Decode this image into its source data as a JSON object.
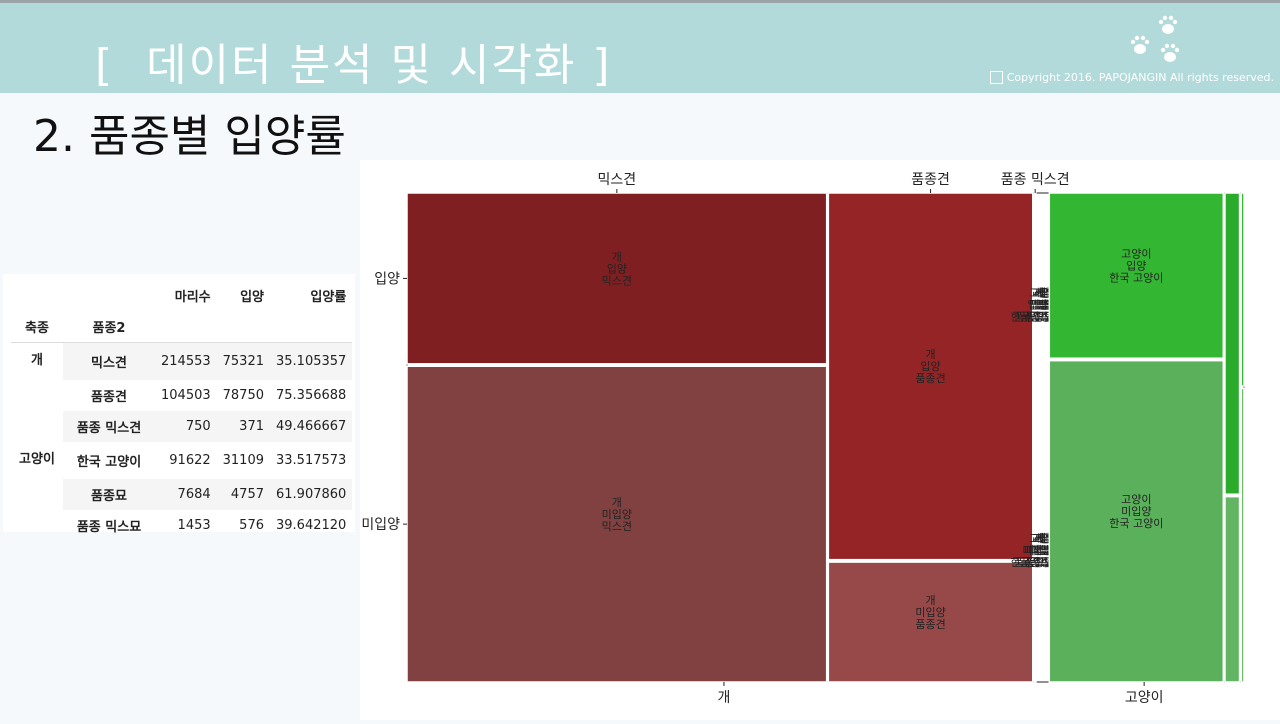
{
  "header": {
    "title": "[  데이터 분석 및 시각화 ]",
    "copyright": "Copyright 2016. PAPOJANGIN All rights reserved."
  },
  "section_title": "2. 품종별 입양률",
  "table": {
    "columns": [
      "마리수",
      "입양",
      "입양률"
    ],
    "index_names": [
      "축종",
      "품종2"
    ],
    "rows": [
      {
        "group": "개",
        "breed": "믹스견",
        "count": "214553",
        "adopted": "75321",
        "rate": "35.105357"
      },
      {
        "group": "",
        "breed": "품종견",
        "count": "104503",
        "adopted": "78750",
        "rate": "75.356688"
      },
      {
        "group": "",
        "breed": "품종 믹스견",
        "count": "750",
        "adopted": "371",
        "rate": "49.466667"
      },
      {
        "group": "고양이",
        "breed": "한국 고양이",
        "count": "91622",
        "adopted": "31109",
        "rate": "33.517573"
      },
      {
        "group": "",
        "breed": "품종묘",
        "count": "7684",
        "adopted": "4757",
        "rate": "61.907860"
      },
      {
        "group": "",
        "breed": "품종 믹스묘",
        "count": "1453",
        "adopted": "576",
        "rate": "39.642120"
      }
    ]
  },
  "chart_data": {
    "type": "mosaic",
    "x_categories": [
      "개",
      "고양이"
    ],
    "y_categories": [
      "입양",
      "미입양"
    ],
    "top_labels": [
      "믹스견",
      "품종견",
      "품종 믹스견"
    ],
    "subgroups": {
      "개": [
        "믹스견",
        "품종견",
        "품종 믹스견",
        "한국 고양이",
        "품종묘",
        "품종 믹스묘"
      ],
      "고양이": [
        "믹스견",
        "품종견",
        "품종 믹스견",
        "한국 고양이",
        "품종묘",
        "품종 믹스묘"
      ]
    },
    "counts": {
      "개": {
        "믹스견": {
          "입양": 75321,
          "미입양": 139232
        },
        "품종견": {
          "입양": 78750,
          "미입양": 25753
        },
        "품종 믹스견": {
          "입양": 371,
          "미입양": 379
        },
        "한국 고양이": {
          "입양": 0,
          "미입양": 0
        },
        "품종묘": {
          "입양": 0,
          "미입양": 0
        },
        "품종 믹스묘": {
          "입양": 0,
          "미입양": 0
        }
      },
      "고양이": {
        "믹스견": {
          "입양": 0,
          "미입양": 0
        },
        "품종견": {
          "입양": 0,
          "미입양": 0
        },
        "품종 믹스견": {
          "입양": 0,
          "미입양": 0
        },
        "한국 고양이": {
          "입양": 31109,
          "미입양": 60513
        },
        "품종묘": {
          "입양": 4757,
          "미입양": 2927
        },
        "품종 믹스묘": {
          "입양": 576,
          "미입양": 877
        }
      }
    },
    "colors": {
      "개": {
        "입양": [
          "#7f1f21",
          "#952426",
          "#a8292b",
          "#b02e30",
          "#b53234",
          "#ba3638"
        ],
        "미입양": [
          "#814141",
          "#974848",
          "#a55050",
          "#ad5555",
          "#b25858",
          "#b75c5c"
        ]
      },
      "고양이": {
        "입양": [
          "#2d9e2d",
          "#21a821",
          "#2fbf2f",
          "#33b733",
          "#2bab2b",
          "#32c032"
        ],
        "미입양": [
          "#55ac55",
          "#61b661",
          "#6ec06e",
          "#5bb05b",
          "#62b562",
          "#6dbd6d"
        ]
      }
    }
  }
}
